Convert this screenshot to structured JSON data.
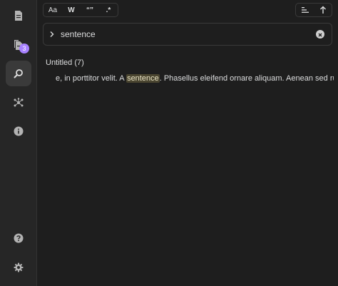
{
  "ribbon": {
    "items": [
      {
        "name": "files",
        "icon": "file-icon"
      },
      {
        "name": "open-files",
        "icon": "files-icon",
        "badge": "3"
      },
      {
        "name": "search",
        "icon": "search-icon",
        "active": true
      },
      {
        "name": "graph",
        "icon": "graph-icon"
      },
      {
        "name": "info",
        "icon": "info-icon"
      }
    ],
    "bottom": [
      {
        "name": "help",
        "icon": "help-icon"
      },
      {
        "name": "settings",
        "icon": "gear-icon"
      }
    ]
  },
  "toolbar": {
    "match_case_label": "Aa",
    "whole_word_label": "W",
    "quotes_label": "“”",
    "regex_label": ".*"
  },
  "search": {
    "value": "sentence",
    "placeholder": ""
  },
  "results": {
    "file_title": "Untitled (7)",
    "line_before": "e, in porttitor velit. A ",
    "match": "sentence",
    "line_after": ". Phasellus eleifend ornare aliquam. Aenean sed rutrum."
  },
  "colors": {
    "accent": "#a882ff",
    "highlight_bg": "#4a4530",
    "background": "#1e1e1e",
    "ribbon": "#262626"
  }
}
